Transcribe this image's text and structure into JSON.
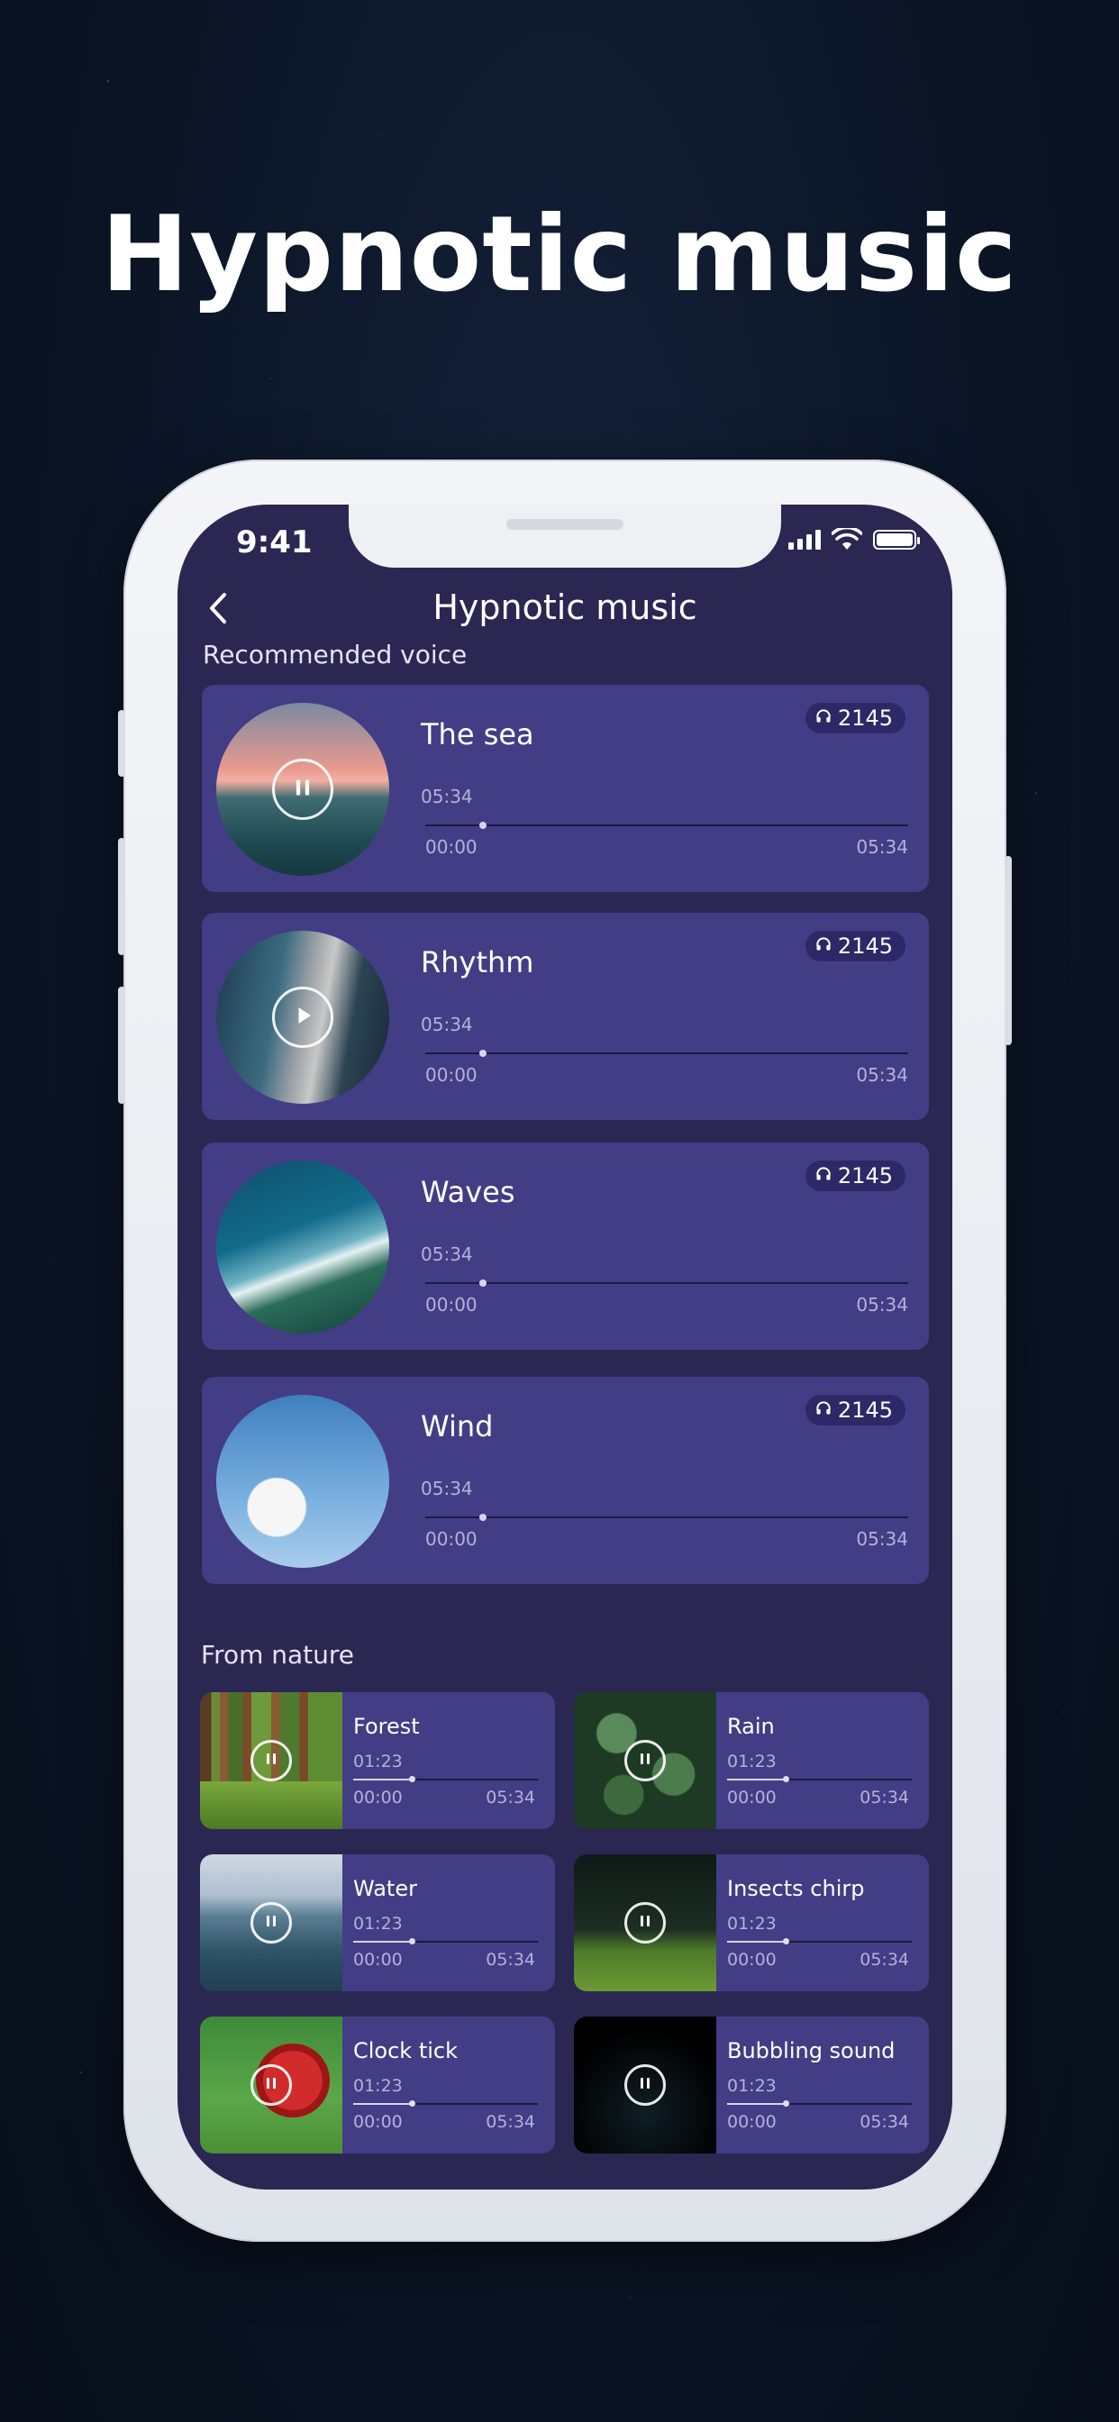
{
  "headline": "Hypnotic music",
  "status": {
    "time": "9:41"
  },
  "nav": {
    "title": "Hypnotic music"
  },
  "sections": {
    "recommended": "Recommended voice",
    "nature": "From nature"
  },
  "recommended": [
    {
      "title": "The sea",
      "duration": "05:34",
      "elapsed": "00:00",
      "total": "05:34",
      "listens": "2145",
      "state": "pause",
      "thumb": "sea"
    },
    {
      "title": "Rhythm",
      "duration": "05:34",
      "elapsed": "00:00",
      "total": "05:34",
      "listens": "2145",
      "state": "play",
      "thumb": "rhythm"
    },
    {
      "title": "Waves",
      "duration": "05:34",
      "elapsed": "00:00",
      "total": "05:34",
      "listens": "2145",
      "state": "none",
      "thumb": "waves"
    },
    {
      "title": "Wind",
      "duration": "05:34",
      "elapsed": "00:00",
      "total": "05:34",
      "listens": "2145",
      "state": "none",
      "thumb": "wind"
    }
  ],
  "nature": [
    {
      "title": "Forest",
      "duration": "01:23",
      "elapsed": "00:00",
      "total": "05:34",
      "thumb": "forest"
    },
    {
      "title": "Rain",
      "duration": "01:23",
      "elapsed": "00:00",
      "total": "05:34",
      "thumb": "rain"
    },
    {
      "title": "Water",
      "duration": "01:23",
      "elapsed": "00:00",
      "total": "05:34",
      "thumb": "water"
    },
    {
      "title": "Insects chirp",
      "duration": "01:23",
      "elapsed": "00:00",
      "total": "05:34",
      "thumb": "insects"
    },
    {
      "title": "Clock tick",
      "duration": "01:23",
      "elapsed": "00:00",
      "total": "05:34",
      "thumb": "clock"
    },
    {
      "title": "Bubbling sound",
      "duration": "01:23",
      "elapsed": "00:00",
      "total": "05:34",
      "thumb": "bubble"
    }
  ],
  "colors": {
    "card": "#433d85",
    "screen": "#2a2752",
    "badge": "#2d2966"
  }
}
